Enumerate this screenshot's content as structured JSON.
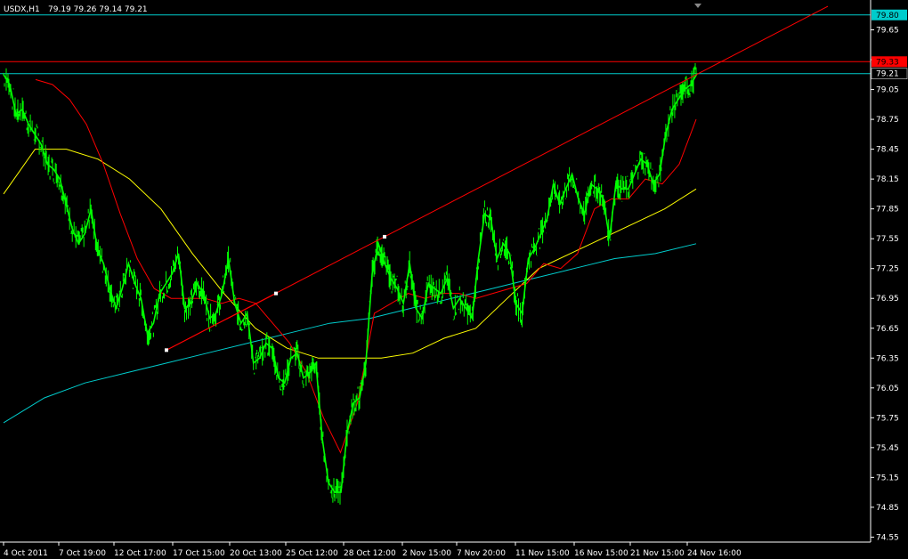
{
  "title": {
    "symbol": "USDX,H1",
    "ohlc": "79.19 79.26 79.14 79.21"
  },
  "colors": {
    "background": "#000000",
    "axis": "#ffffff",
    "price": "#00ff00",
    "ma_fast": "#ff0000",
    "ma_slow": "#ffff00",
    "ma_long": "#00cccc",
    "hline_top": "#00cccc",
    "hline_resistance": "#ff0000",
    "hline_bid": "#00cccc",
    "trendline": "#ff0000",
    "anchor": "#ffffff"
  },
  "chart_data": {
    "type": "line",
    "ylim": [
      74.5,
      79.95
    ],
    "x_tick_labels": [
      "4 Oct 2011",
      "7 Oct 19:00",
      "12 Oct 17:00",
      "17 Oct 15:00",
      "20 Oct 13:00",
      "25 Oct 12:00",
      "28 Oct 12:00",
      "2 Nov 15:00",
      "7 Nov 20:00",
      "11 Nov 15:00",
      "16 Nov 15:00",
      "21 Nov 15:00",
      "24 Nov 16:00"
    ],
    "y_tick_labels": [
      "79.65",
      "79.35",
      "79.05",
      "78.75",
      "78.45",
      "78.15",
      "77.85",
      "77.55",
      "77.25",
      "76.95",
      "76.65",
      "76.35",
      "76.05",
      "75.75",
      "75.45",
      "75.15",
      "74.85",
      "74.55"
    ],
    "y_ticks": [
      79.65,
      79.35,
      79.05,
      78.75,
      78.45,
      78.15,
      77.85,
      77.55,
      77.25,
      76.95,
      76.65,
      76.35,
      76.05,
      75.75,
      75.45,
      75.15,
      74.85,
      74.55
    ],
    "horizontal_lines": [
      {
        "value": 79.8,
        "label": "79.80",
        "color": "#00cccc"
      },
      {
        "value": 79.33,
        "label": "79.33",
        "color": "#ff0000"
      },
      {
        "value": 79.21,
        "label": "79.21",
        "color": "#00cccc"
      }
    ],
    "series": [
      {
        "values": [
          79.2,
          79.1,
          78.8,
          78.85,
          78.7,
          78.6,
          78.5,
          78.3,
          78.25,
          78.15,
          77.9,
          77.65,
          77.5,
          77.6,
          77.85,
          77.45,
          77.3,
          77.05,
          76.85,
          77.05,
          77.3,
          77.1,
          76.95,
          76.6,
          76.7,
          77.0,
          77.1,
          77.2,
          77.4,
          76.85,
          76.9,
          77.1,
          77.0,
          76.75,
          76.8,
          77.0,
          77.35,
          76.9,
          76.7,
          76.8,
          76.3,
          76.35,
          76.5,
          76.45,
          76.15,
          76.1,
          76.35,
          76.4,
          76.15,
          76.2,
          76.3,
          75.55,
          75.1,
          75.0,
          75.0,
          75.6,
          75.9,
          75.95,
          76.3,
          77.2,
          77.5,
          77.3,
          77.15,
          77.05,
          76.9,
          77.3,
          76.85,
          76.75,
          77.1,
          77.05,
          77.0,
          77.15,
          76.85,
          76.95,
          76.85,
          76.75,
          77.35,
          77.8,
          77.75,
          77.35,
          77.5,
          77.4,
          76.9,
          76.8,
          77.35,
          77.45,
          77.6,
          77.75,
          78.1,
          77.9,
          78.05,
          78.2,
          77.95,
          77.8,
          78.1,
          78.05,
          77.95,
          77.55,
          78.1,
          78.05,
          78.05,
          78.2,
          78.35,
          78.3,
          78.1,
          78.2,
          78.6,
          78.85,
          78.95,
          79.05,
          79.1,
          79.21
        ]
      },
      {
        "values": [
          79.15,
          79.1,
          78.95,
          78.7,
          78.3,
          77.8,
          77.35,
          77.05,
          76.95,
          76.95,
          76.95,
          76.9,
          76.95,
          76.9,
          76.7,
          76.5,
          76.2,
          75.75,
          75.4,
          75.9,
          76.8,
          76.9,
          77.0,
          76.95,
          77.0,
          77.0,
          76.95,
          77.0,
          77.05,
          77.1,
          77.3,
          77.25,
          77.4,
          77.85,
          77.95,
          77.95,
          78.15,
          78.1,
          78.3,
          78.75
        ]
      },
      {
        "values": [
          78.0,
          78.45,
          78.45,
          78.35,
          78.15,
          77.85,
          77.4,
          77.0,
          76.65,
          76.45,
          76.35,
          76.35,
          76.35,
          76.4,
          76.55,
          76.65,
          76.95,
          77.25,
          77.4,
          77.55,
          77.7,
          77.85,
          78.05
        ]
      },
      {
        "values": [
          75.7,
          75.95,
          76.1,
          76.2,
          76.3,
          76.4,
          76.5,
          76.6,
          76.7,
          76.75,
          76.85,
          76.95,
          77.05,
          77.15,
          77.25,
          77.35,
          77.4,
          77.5
        ]
      }
    ],
    "trendlines": [
      {
        "from": {
          "x": "13 Oct",
          "y": 76.43
        },
        "to": {
          "x": "31 Oct",
          "y": 77.57
        }
      }
    ],
    "anchor_points": [
      {
        "x": "13 Oct",
        "y": 76.43
      },
      {
        "x": "20 Oct",
        "y": 77.0
      },
      {
        "x": "31 Oct",
        "y": 77.57
      }
    ]
  }
}
